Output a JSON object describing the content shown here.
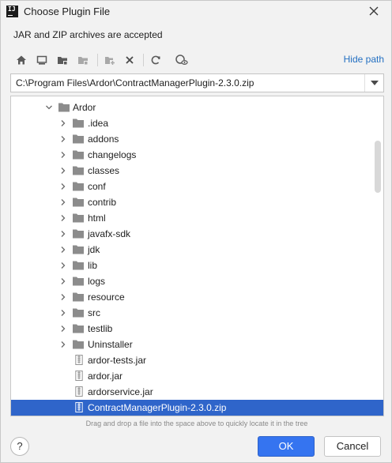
{
  "window": {
    "title": "Choose Plugin File",
    "app_logo_text": "IJ"
  },
  "description": "JAR and ZIP archives are accepted",
  "toolbar": {
    "buttons": [
      "home-icon",
      "desktop-icon",
      "project-folder-icon",
      "module-folder-icon",
      "new-folder-icon",
      "delete-icon",
      "refresh-icon",
      "show-hidden-icon"
    ],
    "hide_path_label": "Hide path"
  },
  "path": {
    "value": "C:\\Program Files\\Ardor\\ContractManagerPlugin-2.3.0.zip"
  },
  "tree": {
    "parent": {
      "label": "Ardor",
      "expanded": true
    },
    "children": [
      {
        "label": ".idea",
        "type": "folder"
      },
      {
        "label": "addons",
        "type": "folder"
      },
      {
        "label": "changelogs",
        "type": "folder"
      },
      {
        "label": "classes",
        "type": "folder"
      },
      {
        "label": "conf",
        "type": "folder"
      },
      {
        "label": "contrib",
        "type": "folder"
      },
      {
        "label": "html",
        "type": "folder"
      },
      {
        "label": "javafx-sdk",
        "type": "folder"
      },
      {
        "label": "jdk",
        "type": "folder"
      },
      {
        "label": "lib",
        "type": "folder"
      },
      {
        "label": "logs",
        "type": "folder"
      },
      {
        "label": "resource",
        "type": "folder"
      },
      {
        "label": "src",
        "type": "folder"
      },
      {
        "label": "testlib",
        "type": "folder"
      },
      {
        "label": "Uninstaller",
        "type": "folder"
      },
      {
        "label": "ardor-tests.jar",
        "type": "jar"
      },
      {
        "label": "ardor.jar",
        "type": "jar"
      },
      {
        "label": "ardorservice.jar",
        "type": "jar"
      },
      {
        "label": "ContractManagerPlugin-2.3.0.zip",
        "type": "zip",
        "selected": true
      }
    ]
  },
  "hint": "Drag and drop a file into the space above to quickly locate it in the tree",
  "footer": {
    "help_label": "?",
    "ok_label": "OK",
    "cancel_label": "Cancel"
  },
  "colors": {
    "accent": "#3574f0",
    "selection": "#2f65ca",
    "link": "#2470c2",
    "folder": "#8c8c8c"
  }
}
